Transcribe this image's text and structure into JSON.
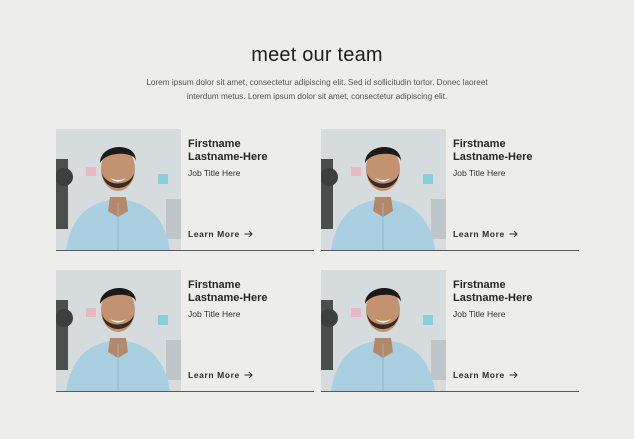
{
  "section": {
    "title": "meet our team",
    "intro": "Lorem ipsum dolor sit amet, consectetur adipiscing elit. Sed id sollicitudin tortor. Donec laoreet interdum metus. Lorem ipsum dolor sit amet, consectetur adipiscing elit."
  },
  "members": [
    {
      "first_name": "Firstname",
      "last_name": "Lastname-Here",
      "job_title": "Job Title Here",
      "link_label": "Learn More"
    },
    {
      "first_name": "Firstname",
      "last_name": "Lastname-Here",
      "job_title": "Job Title Here",
      "link_label": "Learn More"
    },
    {
      "first_name": "Firstname",
      "last_name": "Lastname-Here",
      "job_title": "Job Title Here",
      "link_label": "Learn More"
    },
    {
      "first_name": "Firstname",
      "last_name": "Lastname-Here",
      "job_title": "Job Title Here",
      "link_label": "Learn More"
    }
  ],
  "icons": {
    "link_icon": "arrow-right-icon"
  },
  "colors": {
    "background": "#ededeb",
    "text": "#2b2b2b",
    "divider": "#5a5a5a"
  }
}
